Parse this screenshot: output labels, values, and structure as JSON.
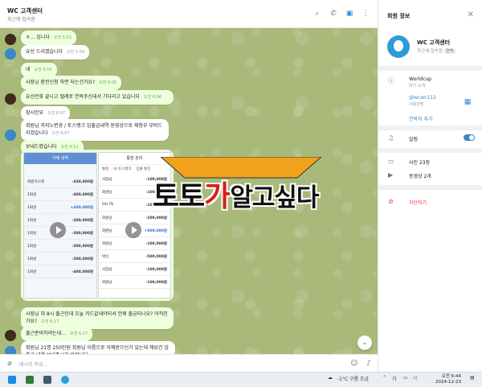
{
  "header": {
    "title": "WC 고객센터",
    "status": "최근에 접속함"
  },
  "messages": [
    {
      "text": "ㅎ… 입니다",
      "time": "오전 5:52",
      "avatar": "user"
    },
    {
      "text": "유선 드리겠습니다",
      "time": "오전 5:54",
      "avatar": "support"
    },
    {
      "text": "네",
      "time": "오전 5:55",
      "avatar": "user"
    },
    {
      "text": "사장님 환전신청 하면 되는건가요?",
      "time": "오전 6:05",
      "avatar": "user"
    },
    {
      "text": "유선전화 끝나고 텔레로 연락주신데서 기다리고 있습니다",
      "time": "오전 6:06",
      "avatar": "user"
    },
    {
      "text": "잠시만요",
      "time": "오전 6:07",
      "avatar": "support"
    },
    {
      "text": "회원님 카지노변경 / 토스랭크 입출금내역 동영상으로 제청부 부탁드리겠습니다",
      "time": "오전 6:07",
      "avatar": "support"
    },
    {
      "text": "보내드렸습니다",
      "time": "오전 6:11",
      "avatar": "user"
    },
    {
      "text": "사장님 혀 8시 출근인데 오늘 카드값내야되서 언제 출금되나요? 아직인가요?",
      "time": "오전 6:17",
      "avatar": "user"
    },
    {
      "text": "출근준비하려는데…",
      "time": "오전 6:17",
      "avatar": "user"
    },
    {
      "text": "회원님 21명 250만원 회원님 이름으로 이체받으신거 있는데 해당건 입출금 내역 보내주시길 바랍니다",
      "time": "",
      "avatar": "support"
    }
  ],
  "screenshot_left": {
    "header": "거래 내역",
    "rows": [
      {
        "name": "회원가스테",
        "amount": "-430,000원"
      },
      {
        "name": "1회성",
        "amount": "-400,000원"
      },
      {
        "name": "1회성",
        "amount": "+400,000원"
      },
      {
        "name": "1회성",
        "amount": "-200,000원"
      },
      {
        "name": "1회성",
        "amount": "-300,000원"
      },
      {
        "name": "1회성",
        "amount": "-300,000원"
      },
      {
        "name": "1회성",
        "amount": "-200,000원"
      },
      {
        "name": "1회성",
        "amount": "-400,000원"
      }
    ]
  },
  "screenshot_right": {
    "header": "통장 관리",
    "tabs": [
      "통합",
      "내 토스뱅크",
      "입출 통장"
    ],
    "rows": [
      {
        "name": "사장님",
        "amount": "-100,000원"
      },
      {
        "name": "회원님",
        "amount": "-100,000원"
      },
      {
        "name": "OH 76",
        "amount": "-100,500원"
      },
      {
        "name": "회원님",
        "amount": "-200,000원"
      },
      {
        "name": "회원님",
        "amount": "+800,000원"
      },
      {
        "name": "회원님",
        "amount": "-100,000원"
      },
      {
        "name": "박신",
        "amount": "-500,000원"
      },
      {
        "name": "사장님",
        "amount": "-100,000원"
      },
      {
        "name": "회원님",
        "amount": "-100,000원"
      }
    ]
  },
  "watermark": {
    "prefix": "토토",
    "ga": "가",
    "rest": "알고싶다"
  },
  "input": {
    "placeholder": "메시지 작성..."
  },
  "panel": {
    "title": "회원 정보",
    "name": "WC 고객센터",
    "status": "최근에 접속함",
    "status_tag": "연락",
    "bio": "Worldcup",
    "bio_caption": "자기 소개",
    "username": "@wcwc112",
    "username_caption": "사용자명",
    "add_contact": "연락처 추가",
    "notifications": "알림",
    "photos": "사진 23장",
    "videos": "동영상 2개",
    "block": "차단하기"
  },
  "taskbar": {
    "weather": "-1°C 구름 조금",
    "ime": "가",
    "time": "오전 6:44",
    "date": "2024-12-23"
  },
  "colors": {
    "accent": "#3a88c9",
    "chat_bg": "#a8b97a",
    "bubble": "#eeffde",
    "time_green": "#5eae4e"
  }
}
